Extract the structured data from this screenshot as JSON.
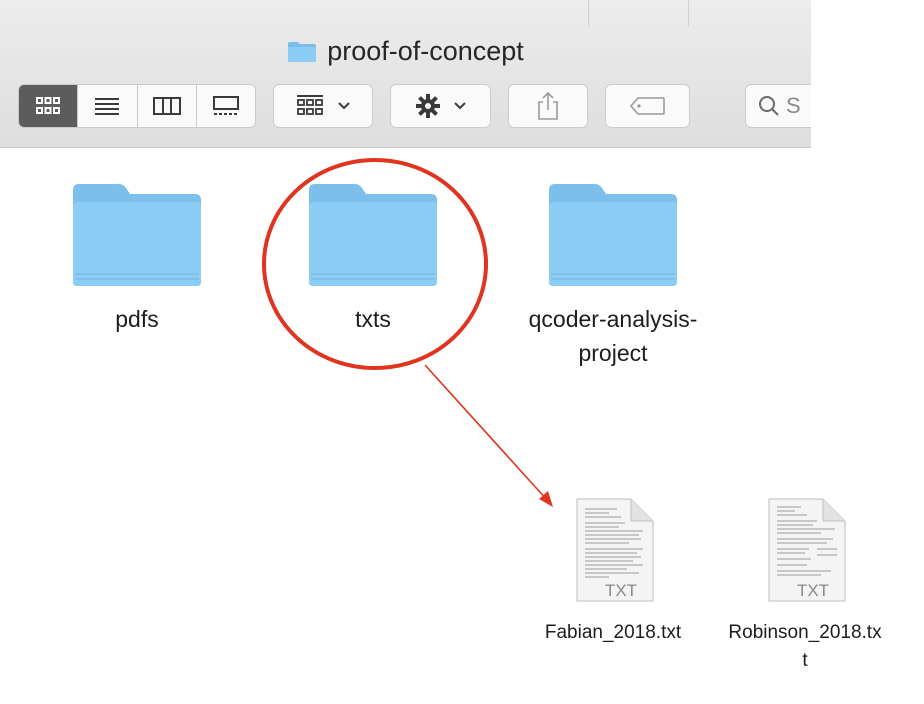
{
  "window": {
    "title": "proof-of-concept"
  },
  "toolbar": {
    "view_modes": [
      {
        "name": "icon-view",
        "active": true
      },
      {
        "name": "list-view",
        "active": false
      },
      {
        "name": "column-view",
        "active": false
      },
      {
        "name": "gallery-view",
        "active": false
      }
    ],
    "group_icon": "grid-group-icon",
    "action_icon": "gear-icon",
    "share_icon": "share-icon",
    "tag_icon": "tag-icon",
    "search_placeholder": "S"
  },
  "folders": [
    {
      "label": "pdfs"
    },
    {
      "label": "txts"
    },
    {
      "label": "qcoder-analysis-project",
      "label_line1": "qcoder-analysis-",
      "label_line2": "project"
    }
  ],
  "files": [
    {
      "label": "Fabian_2018.txt",
      "type_badge": "TXT"
    },
    {
      "label": "Robinson_2018.txt",
      "label_line1": "Robinson_2018.tx",
      "label_line2": "t",
      "type_badge": "TXT"
    }
  ],
  "colors": {
    "folder": "#7ec3f0",
    "annotation": "#e0341f",
    "active_segment": "#5c5c5c"
  }
}
